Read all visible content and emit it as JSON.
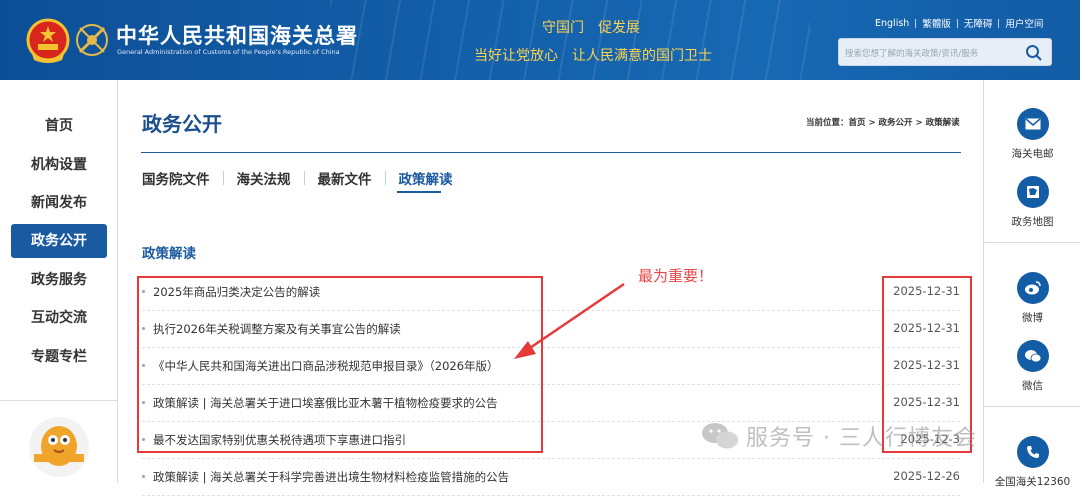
{
  "header": {
    "site_title": "中华人民共和国海关总署",
    "site_subtitle": "General Administration of Customs of the People's Republic of China",
    "slogan_top": "守国门　促发展",
    "slogan_bottom": "当好让党放心　让人民满意的国门卫士",
    "links": [
      "English",
      "繁體版",
      "无障碍",
      "用户空间"
    ],
    "search_placeholder": "搜索您想了解的海关政策/资讯/服务"
  },
  "left_nav": {
    "items": [
      "首页",
      "机构设置",
      "新闻发布",
      "政务公开",
      "政务服务",
      "互动交流",
      "专题专栏"
    ],
    "active_index": 3
  },
  "main": {
    "page_title": "政务公开",
    "breadcrumb": "当前位置：首页 > 政务公开 > 政策解读",
    "tabs": [
      "国务院文件",
      "海关法规",
      "最新文件",
      "政策解读"
    ],
    "active_tab": 3,
    "section_title": "政策解读",
    "rows": [
      {
        "title": "2025年商品归类决定公告的解读",
        "date": "2025-12-31"
      },
      {
        "title": "执行2026年关税调整方案及有关事宜公告的解读",
        "date": "2025-12-31"
      },
      {
        "title": "《中华人民共和国海关进出口商品涉税规范申报目录》（2026年版）",
        "date": "2025-12-31"
      },
      {
        "title": "政策解读 | 海关总署关于进口埃塞俄比亚木薯干植物检疫要求的公告",
        "date": "2025-12-31"
      },
      {
        "title": "最不发达国家特别优惠关税待遇项下享惠进口指引",
        "date": "2025-12-3"
      },
      {
        "title": "政策解读 | 海关总署关于科学完善进出境生物材料检疫监管措施的公告",
        "date": "2025-12-26"
      }
    ]
  },
  "right_bar": {
    "items": [
      {
        "label": "海关电邮",
        "icon": "mail-icon"
      },
      {
        "label": "政务地图",
        "icon": "map-icon"
      },
      {
        "label": "微博",
        "icon": "weibo-icon"
      },
      {
        "label": "微信",
        "icon": "wechat-icon"
      },
      {
        "label": "全国海关12360",
        "icon": "phone-icon"
      }
    ]
  },
  "annotation": {
    "text": "最为重要！",
    "color": "#e63a3a"
  },
  "watermark": {
    "text": "服务号 · 三人行博友会"
  },
  "colors": {
    "header_blue": "#135ca6",
    "accent_blue": "#1a5aa1",
    "slogan_gold": "#ffd34d"
  }
}
